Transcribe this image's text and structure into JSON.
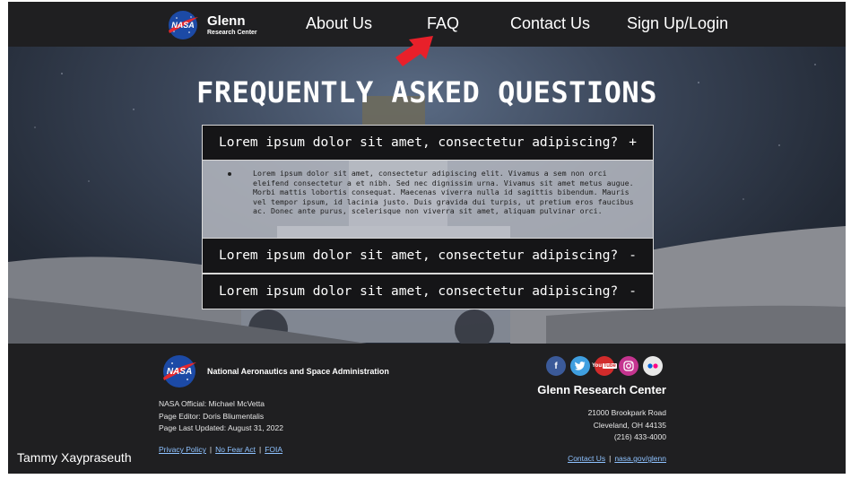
{
  "nav": {
    "brand_name": "Glenn",
    "brand_sub": "Research Center",
    "links": [
      "About Us",
      "FAQ",
      "Contact Us",
      "Sign Up/Login"
    ]
  },
  "hero": {
    "title": "FREQUENTLY ASKED QUESTIONS"
  },
  "faq": {
    "items": [
      {
        "question": "Lorem ipsum dolor sit amet, consectetur adipiscing?",
        "toggle": "+",
        "answer": "Lorem ipsum dolor sit amet, consectetur adipiscing elit. Vivamus a sem non orci eleifend consectetur a et nibh. Sed nec dignissim urna. Vivamus sit amet metus augue. Morbi mattis lobortis consequat. Maecenas viverra nulla id sagittis bibendum. Mauris vel tempor ipsum, id lacinia justo. Duis gravida dui turpis, ut pretium eros faucibus ac. Donec ante purus, scelerisque non viverra sit amet, aliquam pulvinar orci."
      },
      {
        "question": "Lorem ipsum dolor sit amet, consectetur adipiscing?",
        "toggle": "-"
      },
      {
        "question": "Lorem ipsum dolor sit amet, consectetur adipiscing?",
        "toggle": "-"
      }
    ]
  },
  "footer": {
    "logo_text": "NASA",
    "agency": "National Aeronautics and Space Administration",
    "official": "NASA Official: Michael McVetta",
    "editor": "Page Editor: Doris Bliumentalis",
    "updated": "Page Last Updated: August 31, 2022",
    "links": [
      "Privacy Policy",
      "No Fear Act",
      "FOIA"
    ],
    "author": "Tammy Xaypraseuth",
    "center_title": "Glenn Research Center",
    "address": [
      "21000 Brookpark Road",
      "Cleveland, OH 44135",
      "(216) 433-4000"
    ],
    "right_links": [
      "Contact Us",
      "nasa.gov/glenn"
    ],
    "socials": [
      {
        "name": "facebook-icon",
        "glyph": "f",
        "color": "#3b5a99"
      },
      {
        "name": "twitter-icon",
        "glyph": "t",
        "color": "#3f9fe0"
      },
      {
        "name": "youtube-icon",
        "glyph": "You",
        "color": "#d22b2b"
      },
      {
        "name": "instagram-icon",
        "glyph": "◎",
        "color": "#c4348f"
      },
      {
        "name": "flickr-icon",
        "glyph": "●●",
        "color": "#e8e8e8"
      }
    ]
  },
  "colors": {
    "nav_bg": "#1f1f21",
    "arrow": "#e8202a",
    "link": "#8ec2ff"
  }
}
